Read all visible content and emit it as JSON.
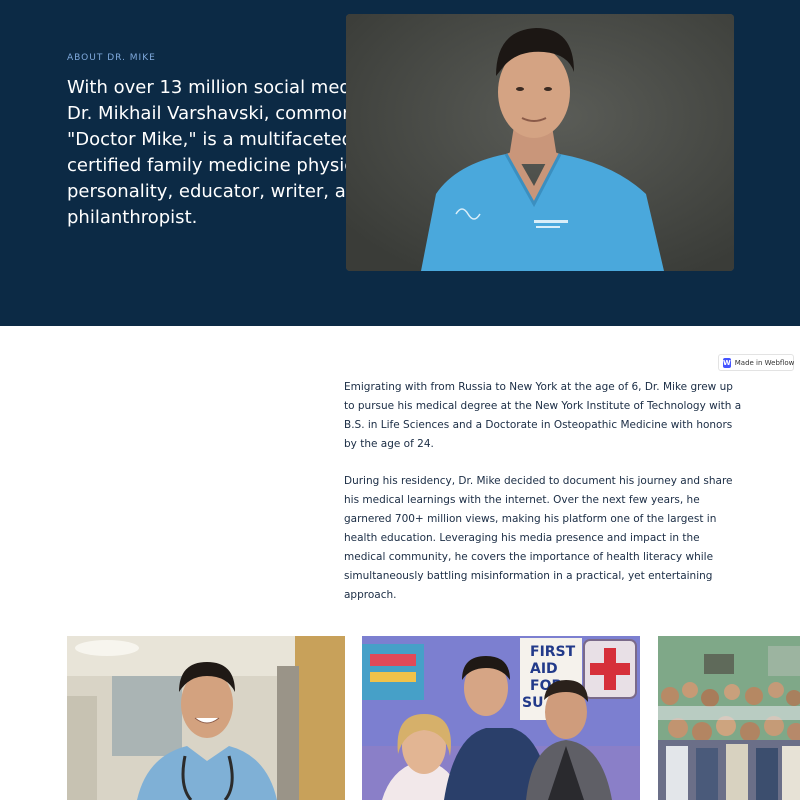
{
  "hero": {
    "eyebrow": "ABOUT DR. MIKE",
    "headline": "With over 13 million social media followers, Dr. Mikhail Varshavski, commonly known as \"Doctor Mike,\" is a multifaceted board-certified family medicine physician, media personality, educator, writer, and philanthropist.",
    "photo_alt": "Portrait of Dr. Mike in blue scrubs"
  },
  "badge": {
    "label": "Made in Webflow"
  },
  "bio": {
    "paragraphs": [
      "Emigrating with from Russia to New York at the age of 6, Dr. Mike grew up to pursue his medical degree at the New York Institute of Technology with a B.S. in Life Sciences and a Doctorate in Osteopathic Medicine with honors by the age of 24.",
      "During his residency, Dr. Mike decided to document his journey and share his medical learnings with the internet. Over the next few years, he garnered 700+ million views, making his platform one of the largest in health education. Leveraging his media presence and impact in the medical community, he covers the importance of health literacy while simultaneously battling misinformation in a practical, yet entertaining approach."
    ]
  },
  "gallery": {
    "tv_sign": [
      "FIRST",
      "AID",
      "FOR",
      "SU  ER"
    ]
  },
  "colors": {
    "hero_bg": "#0c2a45",
    "eyebrow": "#7fa9dc",
    "body_text": "#1a2c44",
    "scrubs_blue": "#4aa8dc"
  }
}
